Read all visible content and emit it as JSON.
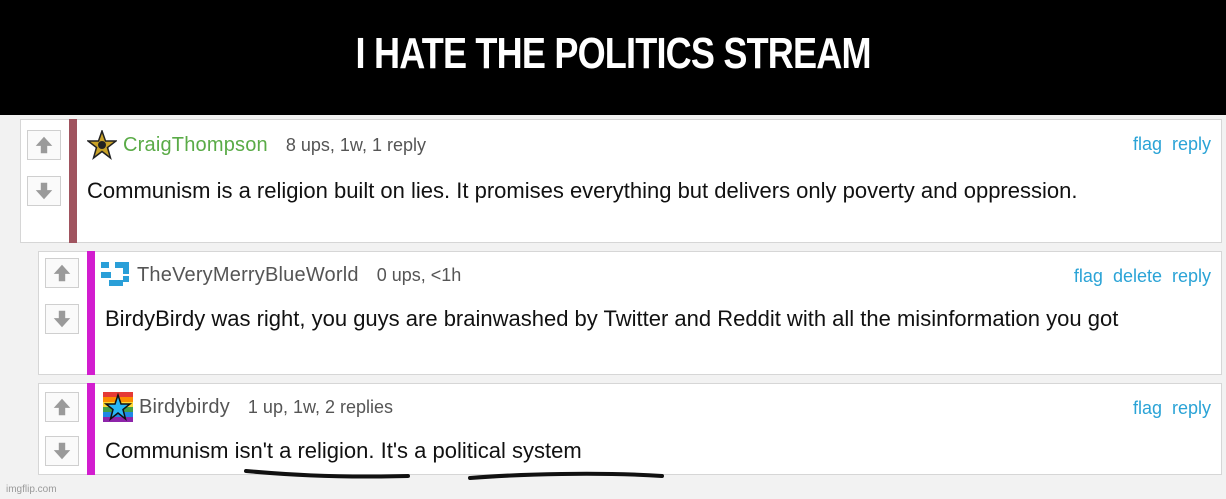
{
  "banner": {
    "title": "I HATE THE POLITICS STREAM"
  },
  "colors": {
    "link": "#2aa3d6",
    "username_green": "#5aab47",
    "username_gray": "#555555",
    "bar_maroon": "#a0545f",
    "bar_magenta": "#d21dcf"
  },
  "icons": {
    "upvote": "up-arrow-icon",
    "downvote": "down-arrow-icon"
  },
  "comments": [
    {
      "username": "CraigThompson",
      "meta": "8 ups, 1w, 1 reply",
      "actions": [
        "flag",
        "reply"
      ],
      "text": "Communism is a religion built on lies. It promises everything but delivers only poverty and oppression.",
      "avatar_icon": "gold-star-icon"
    },
    {
      "username": "TheVeryMerryBlueWorld",
      "meta": "0 ups, <1h",
      "actions": [
        "flag",
        "delete",
        "reply"
      ],
      "text": "BirdyBirdy was right, you guys are brainwashed by Twitter and Reddit with all the misinformation you got",
      "avatar_icon": "blue-pixel-icon"
    },
    {
      "username": "Birdybirdy",
      "meta": "1 up, 1w, 2 replies",
      "actions": [
        "flag",
        "reply"
      ],
      "text": "Communism isn't a religion. It's a political system",
      "avatar_icon": "rainbow-star-icon"
    }
  ],
  "watermark": "imgflip.com"
}
